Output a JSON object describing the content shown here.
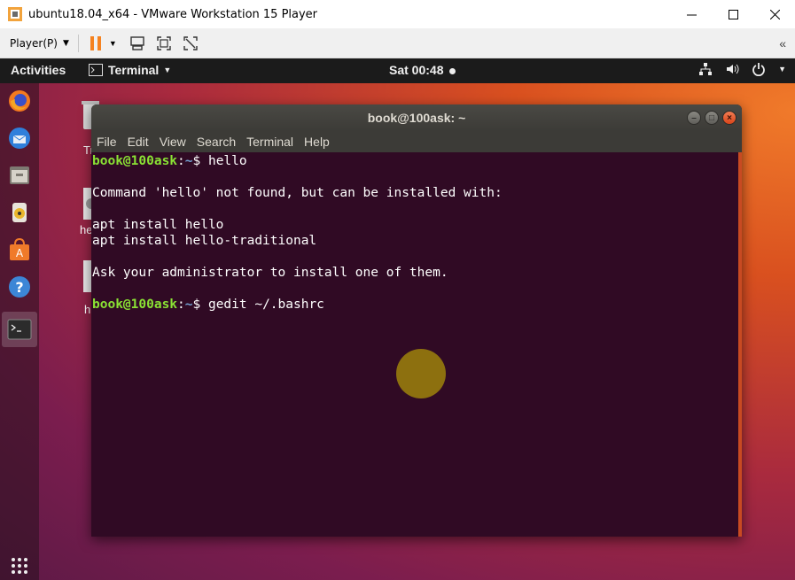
{
  "vm": {
    "title": "ubuntu18.04_x64 - VMware Workstation 15 Player",
    "player_menu": "Player(P)",
    "collapse_label": "«"
  },
  "topbar": {
    "activities": "Activities",
    "app_menu": "Terminal",
    "clock": "Sat 00:48"
  },
  "desktop": {
    "icon_labels": [
      "Tr",
      "he",
      "h"
    ]
  },
  "terminal": {
    "title": "book@100ask: ~",
    "menu": [
      "File",
      "Edit",
      "View",
      "Search",
      "Terminal",
      "Help"
    ],
    "lines": [
      {
        "user": "book@100ask",
        "sep": ":",
        "path": "~",
        "cmd": "$ hello"
      },
      {
        "text": ""
      },
      {
        "text": "Command 'hello' not found, but can be installed with:"
      },
      {
        "text": ""
      },
      {
        "text": "apt install hello"
      },
      {
        "text": "apt install hello-traditional"
      },
      {
        "text": ""
      },
      {
        "text": "Ask your administrator to install one of them."
      },
      {
        "text": ""
      },
      {
        "user": "book@100ask",
        "sep": ":",
        "path": "~",
        "cmd": "$ gedit ~/.bashrc"
      }
    ]
  },
  "colors": {
    "terminal_bg": "#300a24",
    "prompt_user": "#8ae234",
    "prompt_path": "#729fcf",
    "pause_icon": "#f58220"
  }
}
